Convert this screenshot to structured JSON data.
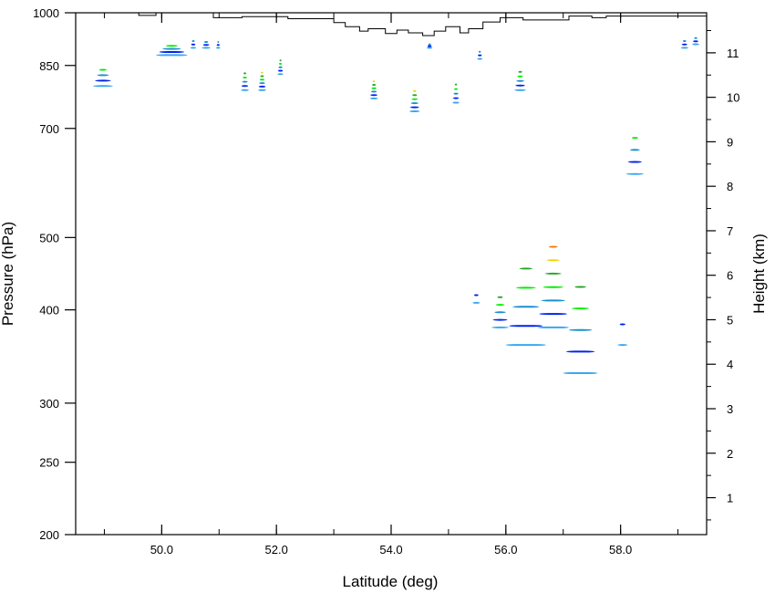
{
  "chart_data": {
    "type": "contour",
    "title": "",
    "xlabel": "Latitude (deg)",
    "ylabel_left": "Pressure (hPa)",
    "ylabel_right": "Height (km)",
    "xlim": [
      48.5,
      59.5
    ],
    "ylim_pressure": [
      1000,
      200
    ],
    "y_scale": "log",
    "ylim_height_km": [
      0.17,
      11.9
    ],
    "x_ticks": [
      "50.0",
      "52.0",
      "54.0",
      "56.0",
      "58.0"
    ],
    "x_tick_values": [
      50,
      52,
      54,
      56,
      58
    ],
    "y_left_ticks": [
      "200",
      "250",
      "300",
      "400",
      "500",
      "700",
      "850",
      "1000"
    ],
    "y_left_tick_values": [
      200,
      250,
      300,
      400,
      500,
      700,
      850,
      1000
    ],
    "y_right_ticks": [
      "1",
      "2",
      "3",
      "4",
      "5",
      "6",
      "7",
      "8",
      "9",
      "10",
      "11"
    ],
    "y_right_tick_values": [
      1,
      2,
      3,
      4,
      5,
      6,
      7,
      8,
      9,
      10,
      11
    ],
    "grid": false,
    "legend": "none",
    "fill_levels": [
      "#3aa6f0",
      "#0022ee",
      "#1a8fd0",
      "#00ee00",
      "#29a52a",
      "#f0d400",
      "#f07a10"
    ],
    "features": [
      {
        "lat_min": 48.8,
        "lat_max": 49.15,
        "p_top": 800,
        "p_bottom": 1000,
        "max_level": 3
      },
      {
        "lat_min": 49.9,
        "lat_max": 50.45,
        "p_top": 880,
        "p_bottom": 1000,
        "max_level": 3
      },
      {
        "lat_min": 50.5,
        "lat_max": 50.6,
        "p_top": 900,
        "p_bottom": 1000,
        "max_level": 2
      },
      {
        "lat_min": 50.7,
        "lat_max": 50.85,
        "p_top": 900,
        "p_bottom": 985,
        "max_level": 2
      },
      {
        "lat_min": 50.95,
        "lat_max": 51.02,
        "p_top": 900,
        "p_bottom": 985,
        "max_level": 2
      },
      {
        "lat_min": 51.38,
        "lat_max": 51.52,
        "p_top": 790,
        "p_bottom": 980,
        "max_level": 4
      },
      {
        "lat_min": 51.68,
        "lat_max": 51.82,
        "p_top": 790,
        "p_bottom": 980,
        "max_level": 5
      },
      {
        "lat_min": 52.02,
        "lat_max": 52.12,
        "p_top": 830,
        "p_bottom": 990,
        "max_level": 4
      },
      {
        "lat_min": 53.63,
        "lat_max": 53.77,
        "p_top": 770,
        "p_bottom": 950,
        "max_level": 5
      },
      {
        "lat_min": 54.32,
        "lat_max": 54.5,
        "p_top": 740,
        "p_bottom": 950,
        "max_level": 5
      },
      {
        "lat_min": 54.62,
        "lat_max": 54.72,
        "p_top": 900,
        "p_bottom": 950,
        "max_level": 2
      },
      {
        "lat_min": 55.07,
        "lat_max": 55.19,
        "p_top": 760,
        "p_bottom": 960,
        "max_level": 4
      },
      {
        "lat_min": 55.42,
        "lat_max": 55.55,
        "p_top": 410,
        "p_bottom": 480,
        "max_level": 1
      },
      {
        "lat_min": 55.5,
        "lat_max": 55.59,
        "p_top": 870,
        "p_bottom": 970,
        "max_level": 2
      },
      {
        "lat_min": 55.75,
        "lat_max": 56.05,
        "p_top": 380,
        "p_bottom": 560,
        "max_level": 4
      },
      {
        "lat_min": 56.0,
        "lat_max": 56.7,
        "p_top": 360,
        "p_bottom": 960,
        "max_level": 4
      },
      {
        "lat_min": 56.15,
        "lat_max": 56.35,
        "p_top": 790,
        "p_bottom": 1000,
        "max_level": 4
      },
      {
        "lat_min": 56.55,
        "lat_max": 57.1,
        "p_top": 380,
        "p_bottom": 1000,
        "max_level": 6
      },
      {
        "lat_min": 57.0,
        "lat_max": 57.6,
        "p_top": 330,
        "p_bottom": 1000,
        "max_level": 4
      },
      {
        "lat_min": 57.95,
        "lat_max": 58.12,
        "p_top": 360,
        "p_bottom": 550,
        "max_level": 1
      },
      {
        "lat_min": 58.1,
        "lat_max": 58.4,
        "p_top": 610,
        "p_bottom": 1000,
        "max_level": 3
      },
      {
        "lat_min": 59.05,
        "lat_max": 59.18,
        "p_top": 900,
        "p_bottom": 1000,
        "max_level": 2
      },
      {
        "lat_min": 59.25,
        "lat_max": 59.37,
        "p_top": 910,
        "p_bottom": 1000,
        "max_level": 2
      }
    ],
    "terrain_pressure": [
      [
        48.5,
        1000
      ],
      [
        49.6,
        1000
      ],
      [
        49.6,
        992
      ],
      [
        49.9,
        992
      ],
      [
        49.9,
        1000
      ],
      [
        50.9,
        1000
      ],
      [
        50.9,
        985
      ],
      [
        51.4,
        985
      ],
      [
        51.4,
        988
      ],
      [
        52.2,
        988
      ],
      [
        52.2,
        982
      ],
      [
        53.0,
        982
      ],
      [
        53.0,
        970
      ],
      [
        53.2,
        970
      ],
      [
        53.2,
        958
      ],
      [
        53.45,
        958
      ],
      [
        53.45,
        945
      ],
      [
        53.6,
        945
      ],
      [
        53.6,
        952
      ],
      [
        53.9,
        952
      ],
      [
        53.9,
        938
      ],
      [
        54.1,
        938
      ],
      [
        54.1,
        948
      ],
      [
        54.3,
        948
      ],
      [
        54.3,
        940
      ],
      [
        54.55,
        940
      ],
      [
        54.55,
        932
      ],
      [
        54.75,
        932
      ],
      [
        54.75,
        945
      ],
      [
        54.95,
        945
      ],
      [
        54.95,
        958
      ],
      [
        55.2,
        958
      ],
      [
        55.2,
        940
      ],
      [
        55.35,
        940
      ],
      [
        55.35,
        952
      ],
      [
        55.6,
        952
      ],
      [
        55.6,
        972
      ],
      [
        55.9,
        972
      ],
      [
        55.9,
        985
      ],
      [
        56.3,
        985
      ],
      [
        56.3,
        978
      ],
      [
        57.1,
        978
      ],
      [
        57.1,
        990
      ],
      [
        57.5,
        990
      ],
      [
        57.5,
        985
      ],
      [
        57.75,
        985
      ],
      [
        57.75,
        990
      ],
      [
        59.5,
        990
      ]
    ]
  }
}
